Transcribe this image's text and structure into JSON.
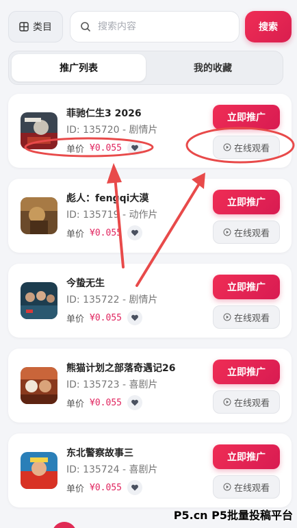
{
  "header": {
    "category_label": "类目",
    "search_placeholder": "搜索内容",
    "search_button": "搜索"
  },
  "tabs": [
    {
      "label": "推广列表",
      "active": true
    },
    {
      "label": "我的收藏",
      "active": false
    }
  ],
  "items": [
    {
      "title": "菲驰仁生3 2026",
      "meta": "ID: 135720 - 剧情片",
      "price_label": "单价",
      "price": "¥0.055",
      "promo": "立即推广",
      "watch": "在线观看"
    },
    {
      "title": "彪人：fengqi大漠",
      "meta": "ID: 135719 - 动作片",
      "price_label": "单价",
      "price": "¥0.055",
      "promo": "立即推广",
      "watch": "在线观看"
    },
    {
      "title": "今蛰无生",
      "meta": "ID: 135722 - 剧情片",
      "price_label": "单价",
      "price": "¥0.055",
      "promo": "立即推广",
      "watch": "在线观看"
    },
    {
      "title": "熊猫计划之部落奇遇记26",
      "meta": "ID: 135723 - 喜剧片",
      "price_label": "单价",
      "price": "¥0.055",
      "promo": "立即推广",
      "watch": "在线观看"
    },
    {
      "title": "东北警察故事三",
      "meta": "ID: 135724 - 喜剧片",
      "price_label": "单价",
      "price": "¥0.055",
      "promo": "立即推广",
      "watch": "在线观看"
    }
  ],
  "watermark": "P5.cn P5批量投稿平台",
  "colors": {
    "accent": "#e0245e",
    "annotation": "#e84a4a"
  }
}
